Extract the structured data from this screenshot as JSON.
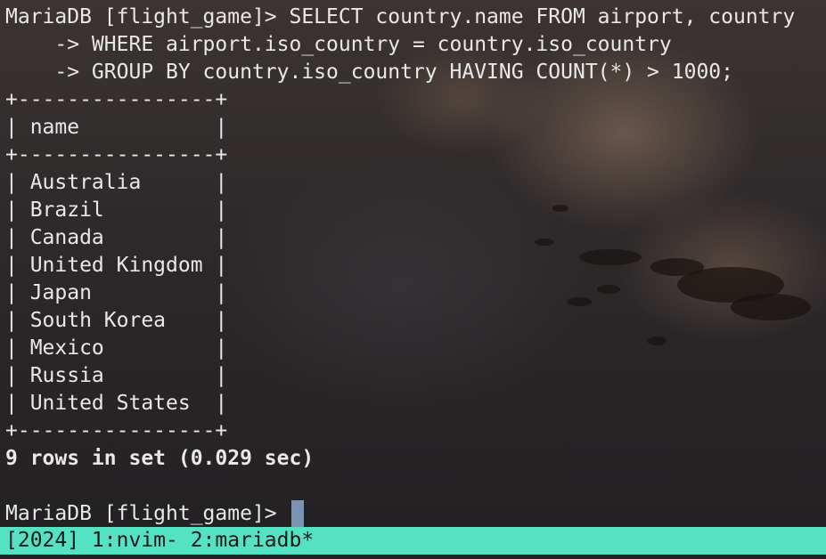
{
  "terminal": {
    "query_line1": "MariaDB [flight_game]> SELECT country.name FROM airport, country",
    "query_line2": "    -> WHERE airport.iso_country = country.iso_country",
    "query_line3": "    -> GROUP BY country.iso_country HAVING COUNT(*) > 1000;",
    "table_border": "+----------------+",
    "header_row": "| name           |",
    "rows": [
      "| Australia      |",
      "| Brazil         |",
      "| Canada         |",
      "| United Kingdom |",
      "| Japan          |",
      "| South Korea    |",
      "| Mexico         |",
      "| Russia         |",
      "| United States  |"
    ],
    "result_summary": "9 rows in set (0.029 sec)",
    "prompt": "MariaDB [flight_game]> "
  },
  "statusbar": {
    "text": "[2024] 1:nvim- 2:mariadb*"
  },
  "colors": {
    "statusbar_bg": "#55e2c2",
    "cursor": "#7a93b0"
  }
}
